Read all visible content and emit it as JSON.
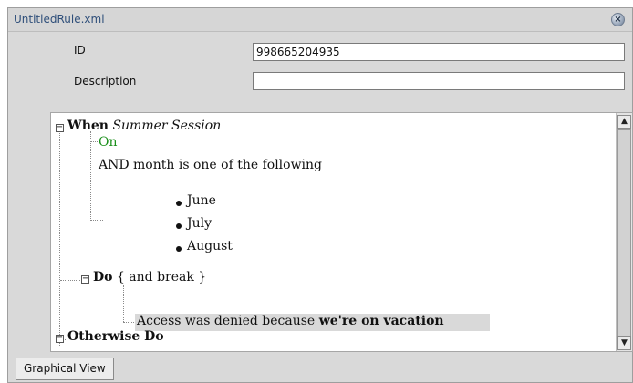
{
  "window": {
    "title": "UntitledRule.xml",
    "close_icon": "close-icon"
  },
  "form": {
    "id_label": "ID",
    "id_value": "998665204935",
    "description_label": "Description",
    "description_value": ""
  },
  "rule": {
    "when_keyword": "When",
    "when_name": "Summer Session",
    "on_label": "On",
    "condition_text": "AND month is one of the following",
    "months": [
      "June",
      "July",
      "August"
    ],
    "do_keyword": "Do",
    "do_modifier": "{ and break }",
    "action_text": "Access was denied because",
    "action_emphasis": "we're on vacation",
    "otherwise_label": "Otherwise Do"
  },
  "tabs": {
    "active": "Graphical View"
  },
  "colors": {
    "on_green": "#1a8f1a",
    "title_blue": "#2f4f7a",
    "highlight": "#d9d9d9"
  },
  "icons": {
    "collapse": "minus-box-icon",
    "scroll_up": "scroll-up-arrow-icon",
    "scroll_down": "scroll-down-arrow-icon",
    "bullet": "bullet-icon"
  }
}
